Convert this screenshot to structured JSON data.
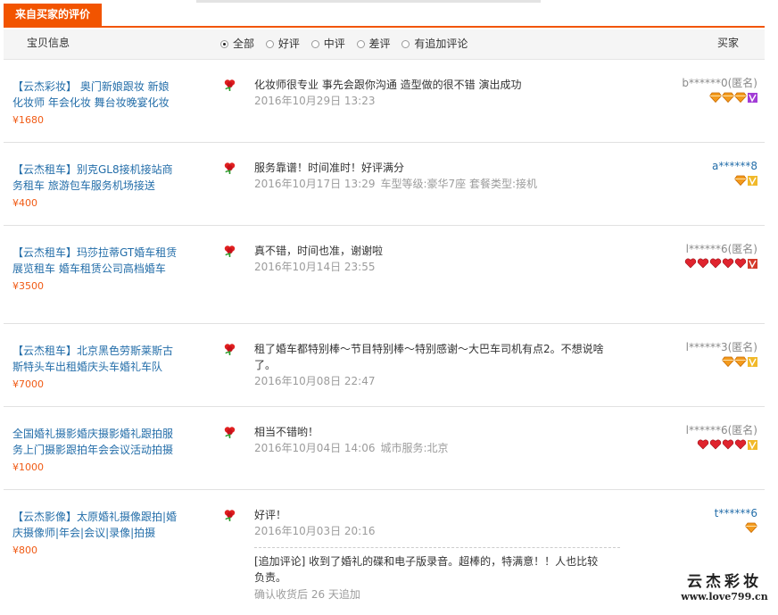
{
  "tab": {
    "label": "来自买家的评价"
  },
  "header": {
    "product_col": "宝贝信息",
    "buyer_col": "买家",
    "filters": [
      {
        "label": "全部",
        "checked": true
      },
      {
        "label": "好评",
        "checked": false
      },
      {
        "label": "中评",
        "checked": false
      },
      {
        "label": "差评",
        "checked": false
      },
      {
        "label": "有追加评论",
        "checked": false
      }
    ]
  },
  "reviews": [
    {
      "product": {
        "title": "【云杰彩妆】 奥门新娘跟妆 新娘化妆师 年会化妆 舞台妆晚宴化妆",
        "price": "¥1680"
      },
      "content": "化妆师很专业 事先会跟你沟通 造型做的很不错 演出成功",
      "date": "2016年10月29日 13:23",
      "spec": "",
      "buyer": {
        "name": "b******0(匿名)",
        "badges": [
          "diamond",
          "diamond",
          "diamond"
        ],
        "vip": "purple"
      }
    },
    {
      "product": {
        "title": "【云杰租车】别克GL8接机接站商务租车 旅游包车服务机场接送",
        "price": "¥400"
      },
      "content": "服务靠谱！时间准时！好评满分",
      "date": "2016年10月17日 13:29",
      "spec": "车型等级:豪华7座  套餐类型:接机",
      "buyer": {
        "name": "a******8",
        "badges": [
          "diamond"
        ],
        "vip": "gold"
      }
    },
    {
      "product": {
        "title": "【云杰租车】玛莎拉蒂GT婚车租赁 展览租车 婚车租赁公司高档婚车",
        "price": "¥3500"
      },
      "content": "真不错，时间也准，谢谢啦",
      "date": "2016年10月14日 23:55",
      "spec": "",
      "buyer": {
        "name": "l******6(匿名)",
        "badges": [
          "heart",
          "heart",
          "heart",
          "heart",
          "heart"
        ],
        "vip": "red"
      }
    },
    {
      "product": {
        "title": "【云杰租车】北京黑色劳斯莱斯古斯特头车出租婚庆头车婚礼车队",
        "price": "¥7000"
      },
      "content": "租了婚车都特别棒～节目特别棒～特别感谢～大巴车司机有点2。不想说啥了。",
      "date": "2016年10月08日 22:47",
      "spec": "",
      "buyer": {
        "name": "l******3(匿名)",
        "badges": [
          "diamond",
          "diamond"
        ],
        "vip": "gold"
      }
    },
    {
      "product": {
        "title": "全国婚礼摄影婚庆摄影婚礼跟拍服务上门摄影跟拍年会会议活动拍摄",
        "price": "¥1000"
      },
      "content": "相当不错哟！",
      "date": "2016年10月04日 14:06",
      "spec": "城市服务:北京",
      "buyer": {
        "name": "l******6(匿名)",
        "badges": [
          "heart",
          "heart",
          "heart",
          "heart"
        ],
        "vip": "gold"
      }
    },
    {
      "product": {
        "title": "【云杰影像】太原婚礼摄像跟拍|婚庆摄像师|年会|会议|录像|拍摄",
        "price": "¥800"
      },
      "content": "好评！",
      "date": "2016年10月03日 20:16",
      "spec": "",
      "buyer": {
        "name": "t******6",
        "badges": [
          "diamond"
        ],
        "vip": ""
      },
      "append": {
        "content": "[追加评论] 收到了婚礼的碟和电子版录音。超棒的，特满意！！人也比较负责。",
        "note": "确认收货后 26 天追加"
      }
    }
  ],
  "watermark": {
    "title": "云杰彩妆",
    "url": "www.love799.cn"
  },
  "colors": {
    "accent": "#f25400",
    "link": "#246ea9",
    "price": "#f05a14"
  }
}
